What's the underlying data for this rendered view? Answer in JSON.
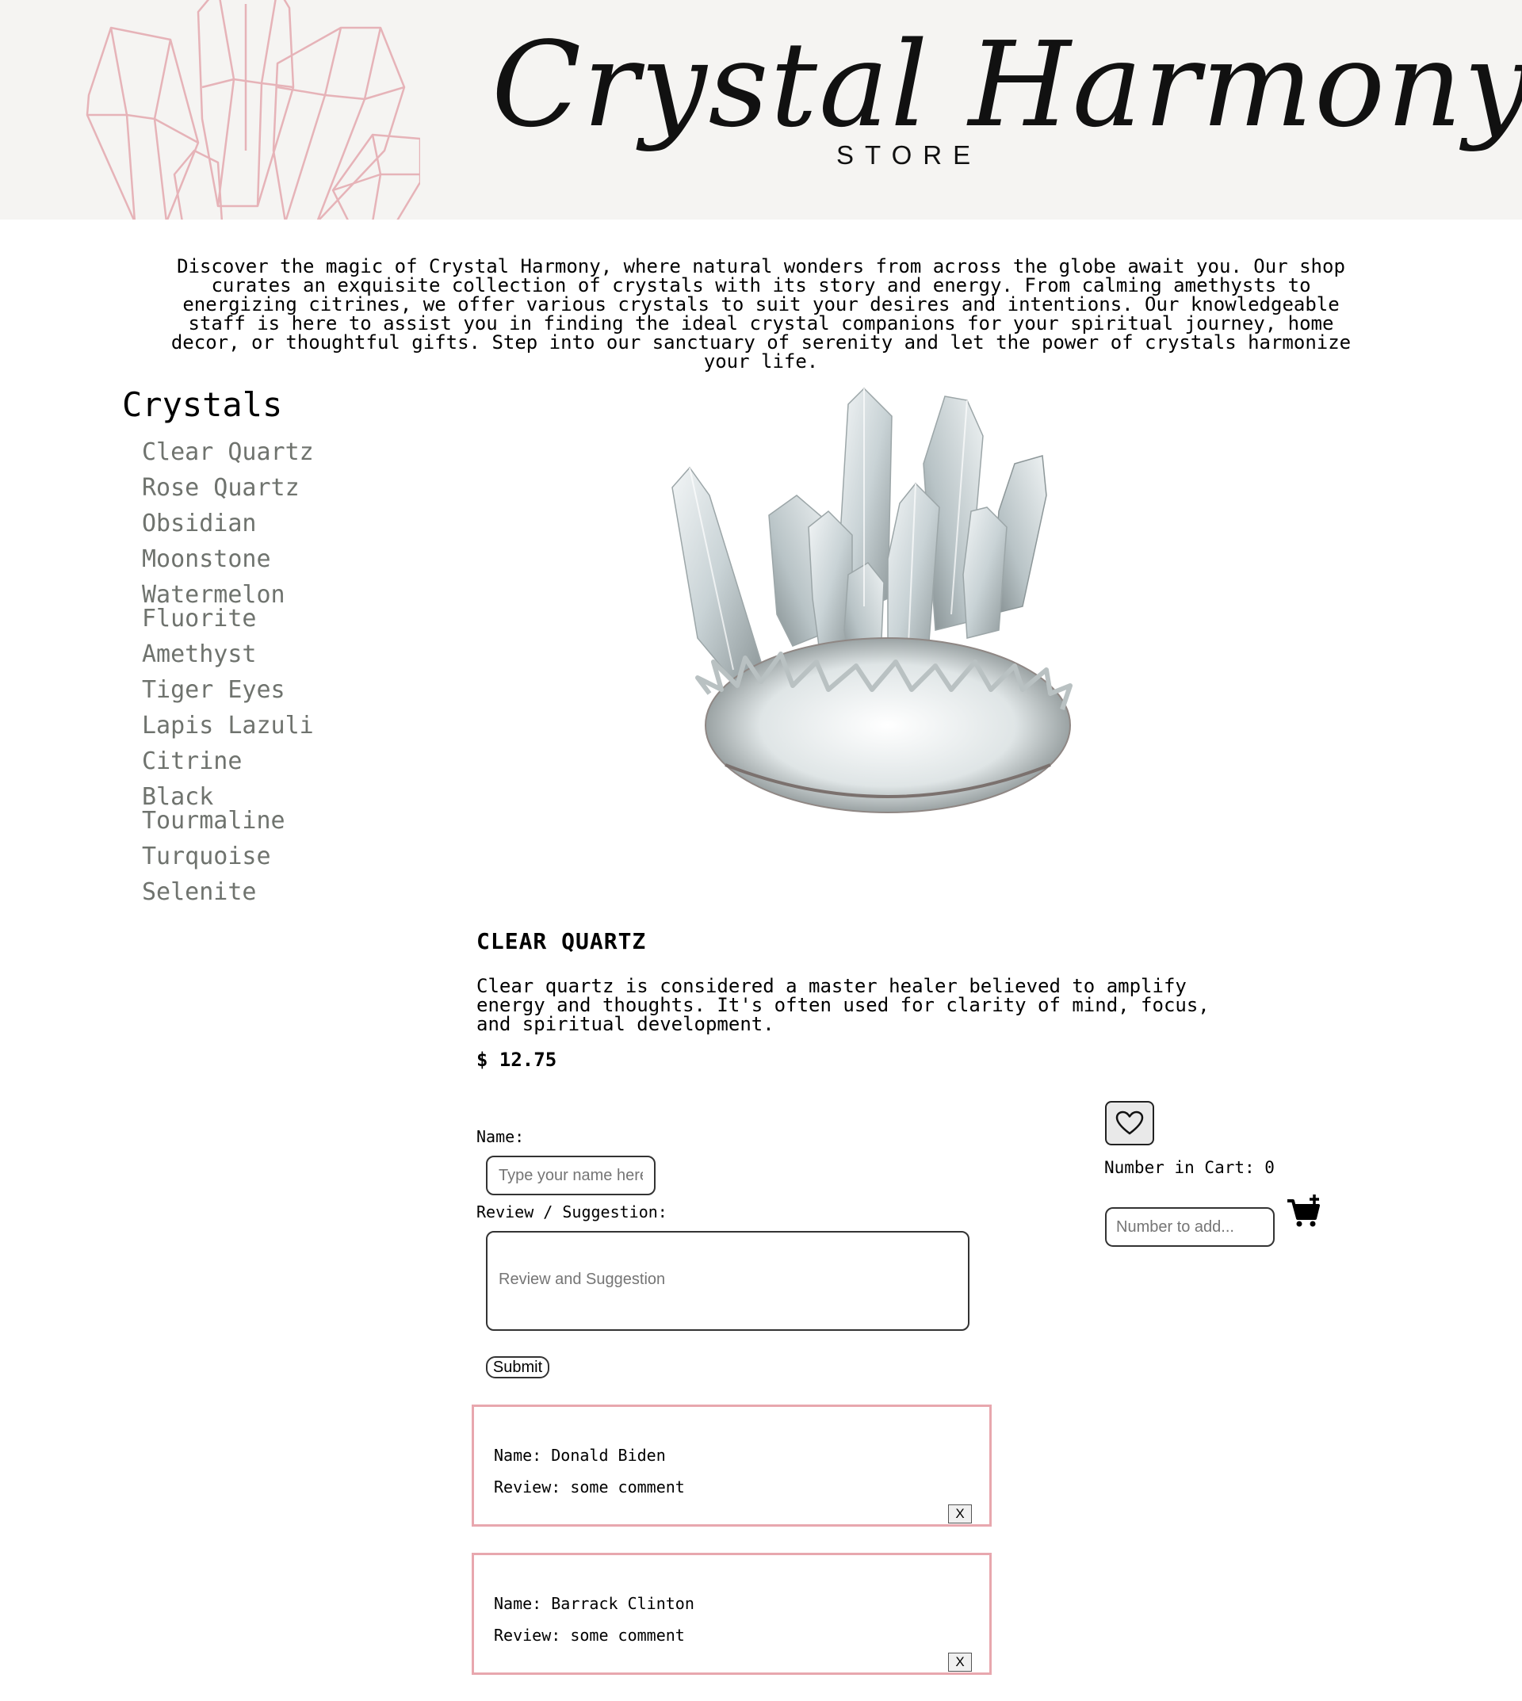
{
  "banner": {
    "title": "Crystal Harmony",
    "subtitle": "STORE",
    "art_color": "#e6b3b8",
    "background": "#f5f4f2"
  },
  "intro": {
    "text": "Discover the magic of Crystal Harmony, where natural wonders from across the globe await you. Our shop curates an exquisite collection of crystals with its story and energy. From calming amethysts to energizing citrines, we offer various crystals to suit your desires and intentions. Our knowledgeable staff is here to assist you in finding the ideal crystal companions for your spiritual journey, home decor, or thoughtful gifts. Step into our sanctuary of serenity and let the power of crystals harmonize your life."
  },
  "sidebar": {
    "title": "Crystals",
    "items": [
      {
        "label": "Clear Quartz"
      },
      {
        "label": "Rose Quartz"
      },
      {
        "label": "Obsidian"
      },
      {
        "label": "Moonstone"
      },
      {
        "label": "Watermelon Fluorite"
      },
      {
        "label": "Amethyst"
      },
      {
        "label": "Tiger Eyes"
      },
      {
        "label": "Lapis Lazuli"
      },
      {
        "label": "Citrine"
      },
      {
        "label": "Black Tourmaline"
      },
      {
        "label": "Turquoise"
      },
      {
        "label": "Selenite"
      }
    ]
  },
  "product": {
    "name": "CLEAR QUARTZ",
    "description": "Clear quartz is considered a master healer believed to amplify energy and thoughts. It's often used for clarity of mind, focus, and spiritual development.",
    "price": "$ 12.75"
  },
  "review_form": {
    "name_label": "Name:",
    "name_placeholder": "Type your name here",
    "review_label": "Review / Suggestion:",
    "review_placeholder": "Review and Suggestion",
    "submit_label": "Submit"
  },
  "reviews": [
    {
      "name": "Name: Donald Biden",
      "text": "Review: some comment",
      "delete_label": "X"
    },
    {
      "name": "Name: Barrack Clinton",
      "text": "Review: some comment",
      "delete_label": "X"
    }
  ],
  "cart": {
    "count_text": "Number in Cart: 0",
    "input_placeholder": "Number to add...",
    "favorite_icon": "heart-icon",
    "add_icon": "cart-plus-icon"
  },
  "colors": {
    "review_border": "#e8a7ae",
    "sidebar_text": "#6f736e"
  }
}
